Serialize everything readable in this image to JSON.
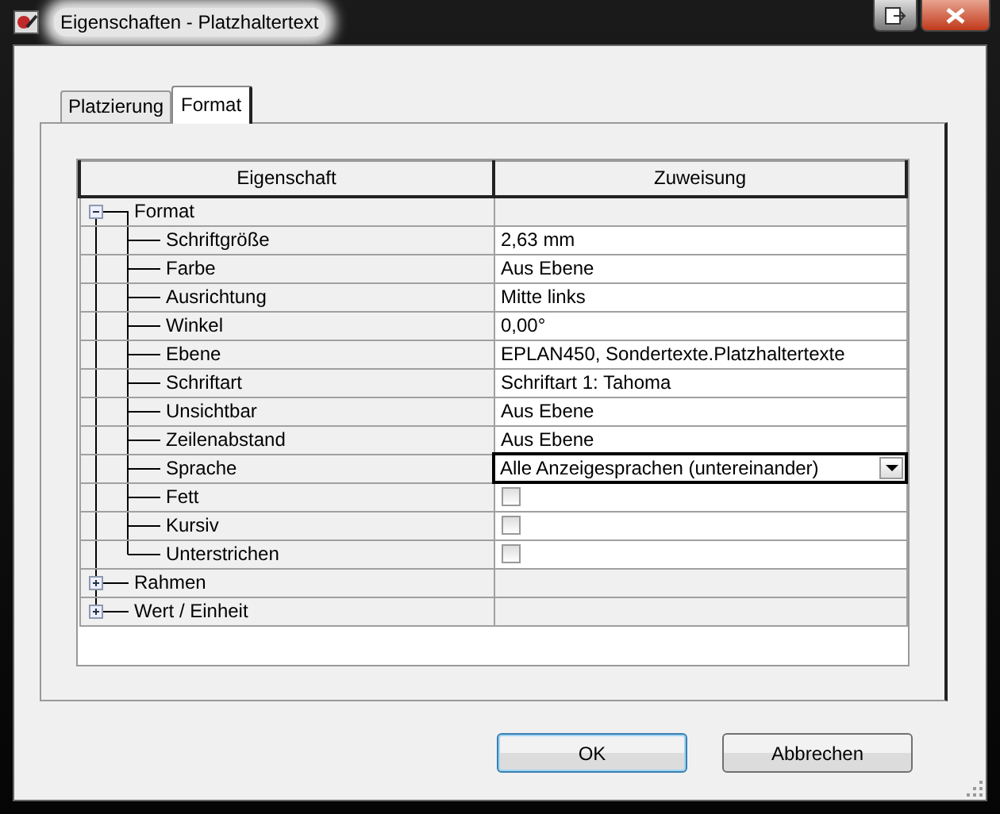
{
  "window": {
    "title": "Eigenschaften - Platzhaltertext"
  },
  "tabs": [
    {
      "label": "Platzierung",
      "selected": false
    },
    {
      "label": "Format",
      "selected": true
    }
  ],
  "table": {
    "columns": [
      "Eigenschaft",
      "Zuweisung"
    ],
    "groups": [
      {
        "name": "Format",
        "expanded": true,
        "children": [
          {
            "name": "Schriftgröße",
            "kind": "text",
            "value": "2,63 mm"
          },
          {
            "name": "Farbe",
            "kind": "text",
            "value": "Aus Ebene"
          },
          {
            "name": "Ausrichtung",
            "kind": "text",
            "value": "Mitte links"
          },
          {
            "name": "Winkel",
            "kind": "text",
            "value": "0,00°"
          },
          {
            "name": "Ebene",
            "kind": "text",
            "value": "EPLAN450, Sondertexte.Platzhaltertexte"
          },
          {
            "name": "Schriftart",
            "kind": "text",
            "value": "Schriftart 1: Tahoma"
          },
          {
            "name": "Unsichtbar",
            "kind": "text",
            "value": "Aus Ebene"
          },
          {
            "name": "Zeilenabstand",
            "kind": "text",
            "value": "Aus Ebene"
          },
          {
            "name": "Sprache",
            "kind": "dropdown",
            "value": "Alle Anzeigesprachen (untereinander)"
          },
          {
            "name": "Fett",
            "kind": "checkbox",
            "checked": false
          },
          {
            "name": "Kursiv",
            "kind": "checkbox",
            "checked": false
          },
          {
            "name": "Unterstrichen",
            "kind": "checkbox",
            "checked": false
          }
        ]
      },
      {
        "name": "Rahmen",
        "expanded": false
      },
      {
        "name": "Wert / Einheit",
        "expanded": false
      }
    ]
  },
  "buttons": [
    {
      "label": "OK",
      "default": true
    },
    {
      "label": "Abbrechen",
      "default": false
    }
  ]
}
